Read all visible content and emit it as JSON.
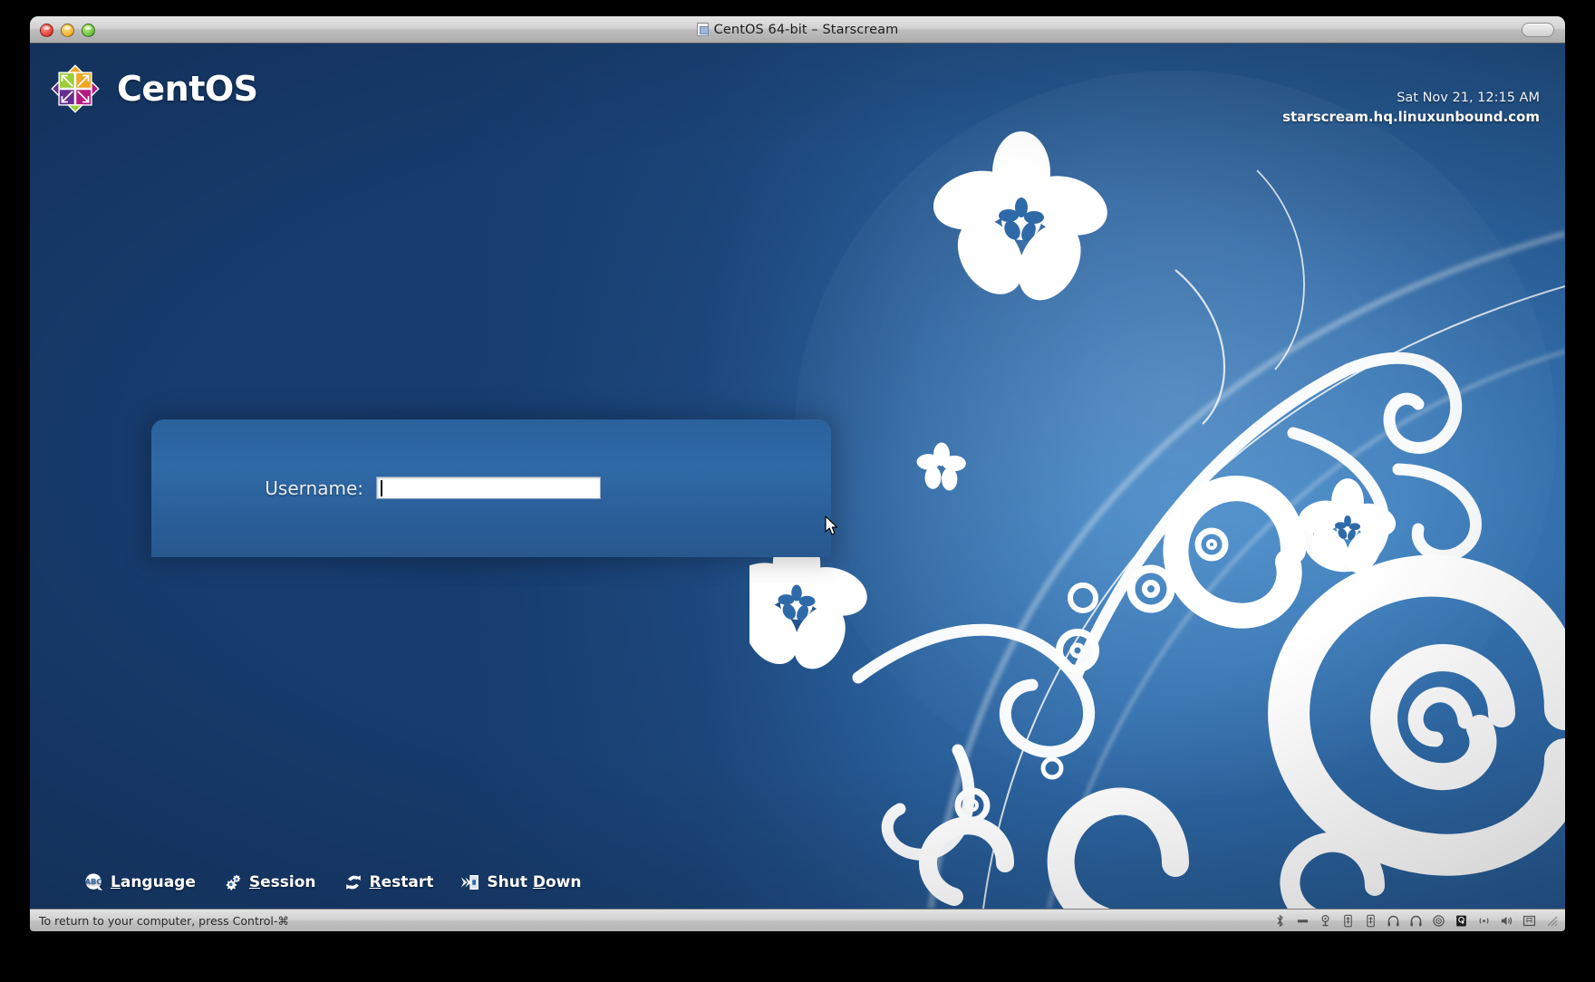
{
  "window": {
    "title": "CentOS 64-bit – Starscream",
    "doc_icon": "document-icon",
    "controls": {
      "close": "close-button",
      "minimize": "minimize-button",
      "zoom": "zoom-button",
      "fullscreen": "fullscreen-button"
    }
  },
  "login_screen": {
    "brand": {
      "logo": "centos-logo",
      "name": "CentOS"
    },
    "clock": {
      "datetime": "Sat Nov 21, 12:15 AM",
      "hostname": "starscream.hq.linuxunbound.com"
    },
    "form": {
      "username_label": "Username:",
      "username_value": "",
      "username_placeholder": ""
    },
    "actions": [
      {
        "id": "language",
        "icon": "language-icon",
        "pre": "",
        "mnemonic": "L",
        "post": "anguage"
      },
      {
        "id": "session",
        "icon": "session-icon",
        "pre": "",
        "mnemonic": "S",
        "post": "ession"
      },
      {
        "id": "restart",
        "icon": "restart-icon",
        "pre": "",
        "mnemonic": "R",
        "post": "estart"
      },
      {
        "id": "shutdown",
        "icon": "shutdown-icon",
        "pre": "Shut ",
        "mnemonic": "D",
        "post": "own"
      }
    ]
  },
  "statusbar": {
    "hint": "To return to your computer, press Control-⌘",
    "icons": [
      {
        "name": "bluetooth-icon",
        "active": false
      },
      {
        "name": "hard-disk-icon",
        "active": false
      },
      {
        "name": "camera-icon",
        "active": false
      },
      {
        "name": "usb-icon",
        "active": false
      },
      {
        "name": "usb-icon",
        "active": false
      },
      {
        "name": "headphones-icon",
        "active": false
      },
      {
        "name": "headphones-icon",
        "active": false
      },
      {
        "name": "cd-drive-icon",
        "active": false
      },
      {
        "name": "hard-disk-active-icon",
        "active": true
      },
      {
        "name": "network-icon",
        "active": false
      },
      {
        "name": "sound-icon",
        "active": false
      },
      {
        "name": "shared-folders-icon",
        "active": false
      }
    ],
    "resize_grip": "resize-grip"
  },
  "colors": {
    "desktop_blue": "#2f6aa8",
    "desktop_navy": "#173c6e",
    "panel_blue": "#2a629e",
    "accent_white": "#ffffff",
    "logo_green": "#9ccd3a",
    "logo_orange": "#efa724",
    "logo_purple": "#662e91",
    "logo_magenta": "#b5197f"
  }
}
